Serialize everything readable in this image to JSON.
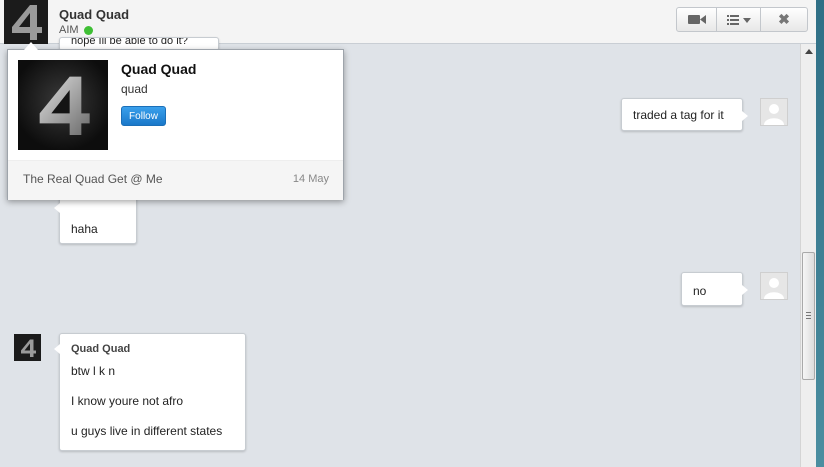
{
  "header": {
    "name": "Quad Quad",
    "service": "AIM",
    "status_color": "#3fbf35"
  },
  "header_buttons": {
    "video_icon": "video-camera-icon",
    "menu_icon": "list-menu-icon",
    "close_label": "✖"
  },
  "popup": {
    "name": "Quad Quad",
    "handle": "quad",
    "follow_label": "Follow",
    "bio": "The Real Quad Get @ Me",
    "date": "14 May"
  },
  "messages": {
    "hidden_top": "hope Ill be able to do it?",
    "traded": "traded a tag for it",
    "haha": "haha",
    "no": "no",
    "group_sender": "Quad Quad",
    "group_lines": [
      "btw l k n",
      "I know youre not afro",
      "u guys live in different states"
    ]
  },
  "colors": {
    "accent": "#1a78c9",
    "background": "#dfe3e8"
  }
}
